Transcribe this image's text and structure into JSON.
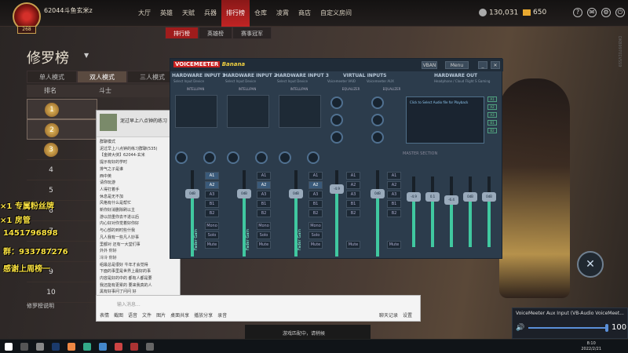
{
  "game": {
    "username": "62044斗鱼玄米z",
    "level": "268",
    "nav": [
      "大厅",
      "英雄",
      "天赋",
      "兵器",
      "排行榜",
      "仓库",
      "凌霄",
      "商店",
      "自定义房间"
    ],
    "coins": "130,031",
    "gems": "650",
    "subtabs": [
      "排行榜",
      "英雄榜",
      "赛事冠军"
    ],
    "page_title": "修罗榜",
    "mode_tabs": [
      "单人模式",
      "双人模式",
      "三人模式"
    ],
    "col_rank": "排名",
    "col_name": "斗士",
    "ranks": [
      "1",
      "2",
      "3",
      "4",
      "5",
      "6",
      "7",
      "8",
      "9",
      "10"
    ],
    "note": "修罗榜说明",
    "watermark": "DKB99701VSS9"
  },
  "overlay": {
    "line1": "×1 专属粉丝牌",
    "line2": "×1 房管",
    "line3": "1451796898",
    "line4": "群：933787276",
    "line5": "感谢上周榜一"
  },
  "chat": {
    "title": "泥过早上八点钟的练习",
    "lines": [
      "群聊模式",
      "泥过早上八点钟的练习群聊(535)",
      "【金牌大侠】62044-玄米",
      "提示有好的学时",
      "排气之子是谁",
      "西中英",
      "请你玩游",
      "人得打着手",
      "休息是无不加",
      "风格有什么是帮忙",
      "新你好消删除刷以主",
      "游以前重你去不进以后",
      "内心好对你觉着好你好",
      "与心部的到时些什我",
      "凡人我有一些凡人妙事",
      "里都对 还有一大堂们事",
      "外外  你好",
      "冷冷  你好",
      "组最总是很好 牛年才会觉得",
      "下面的事里是世界上最好的事",
      "内容是好的中的 都有人都是要",
      "我还能有更累的 要来我真的人",
      "黑有好事问了问问 好"
    ]
  },
  "chat_input": {
    "placeholder": "输入消息...",
    "tools": [
      "表情",
      "截图",
      "语音",
      "文件",
      "图片"
    ],
    "extra1": "桌面共享",
    "extra2": "播放分享",
    "extra3": "录音",
    "right": [
      "聊天记录",
      "设置"
    ]
  },
  "voicemeeter": {
    "logo": "VOICEMEETER",
    "edition": "Banana",
    "vban": "VBAN",
    "menu": "Menu",
    "hw_inputs": [
      "HARDWARE INPUT 1",
      "HARDWARE INPUT 2",
      "HARDWARE INPUT 3"
    ],
    "hw_sub": [
      "Select Input Device",
      "Select Input Device",
      "Select Input Device"
    ],
    "virtual_inputs": "VIRTUAL INPUTS",
    "virtual_names": [
      "Voicemeeter VAIO",
      "Voicemeeter AUX"
    ],
    "hw_out": "HARDWARE OUT",
    "hw_out_device": "Headphone / Cloud Flight S Gaming",
    "intellipan": "INTELLIPAN",
    "fader_label": "Fader Gain",
    "gain_values": [
      "0dB",
      "0dB",
      "0dB",
      "-4.9",
      "0dB"
    ],
    "bus_buttons": [
      "A1",
      "A2",
      "A3",
      "B1",
      "B2",
      "Mono",
      "Solo",
      "Mute"
    ],
    "cassette_text": "Click to Select Audio file for Playback",
    "master_section": "MASTER SECTION",
    "master_values": [
      "-4.9",
      "0.1",
      "-6.4",
      "0dB",
      "0dB"
    ],
    "equalizer": "EQUALIZER"
  },
  "volume": {
    "title": "VoiceMeeter Aux Input (VB-Audio VoiceMeet...",
    "value": "100"
  },
  "queue": {
    "text": "游戏匹配中，请稍候"
  },
  "taskbar": {
    "time": "8:10",
    "date": "2022/2/21"
  }
}
